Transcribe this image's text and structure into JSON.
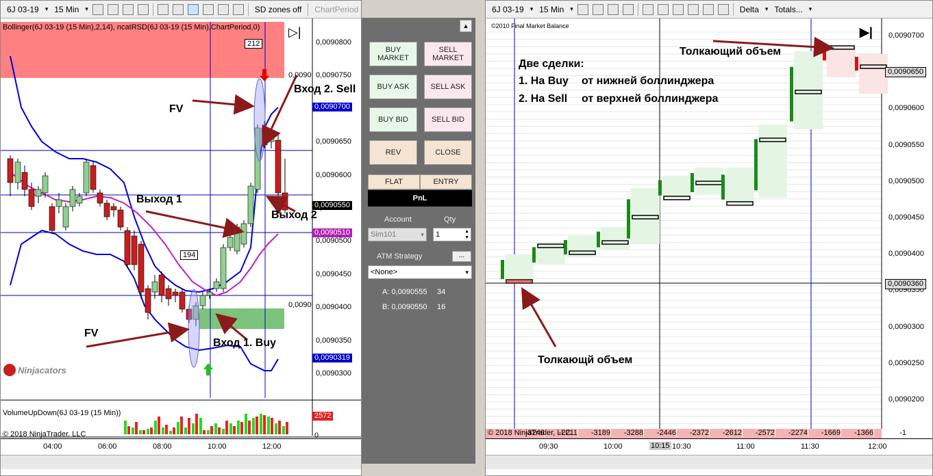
{
  "left": {
    "toolbar": {
      "instrument": "6J 03-19",
      "timeframe": "15 Min",
      "zones": "SD zones off",
      "chart_period": "ChartPeriod"
    },
    "indicator_label": "Bollinger(6J 03-19 (15 Min),2,14), ncatRSD(6J 03-19 (15 Min),ChartPeriod,0)",
    "box_212": "212",
    "box_194": "194",
    "price_axis": [
      "0,0090800",
      "0,0090750",
      "0,0090700",
      "0,0090650",
      "0,0090600",
      "0,0090550",
      "0,0090500",
      "0,0090450",
      "0,0090400",
      "0,0090350",
      "0,0090300"
    ],
    "partial_labels": [
      "0,0090",
      "0,0090"
    ],
    "tags": {
      "t1": "0,0090700",
      "t2": "0,0090550",
      "t3": "0,0090510",
      "t4": "0,0090319"
    },
    "annotations": {
      "fv_top": "FV",
      "fv_bottom": "FV",
      "entry_sell": "Вход 2. Sell",
      "exit1": "Выход 1",
      "exit2": "Выход 2",
      "entry_buy": "Вход 1. Buy"
    },
    "watermark": "Ninjacators",
    "volume": {
      "label": "VolumeUpDown(6J 03-19 (15 Min))",
      "tag": "2572",
      "zero": "0",
      "up": [
        20,
        10,
        6,
        8,
        20,
        10,
        5,
        18,
        10,
        16,
        24,
        6,
        16,
        8,
        16,
        20,
        30,
        24,
        30,
        26,
        16,
        12
      ],
      "down": [
        12,
        18,
        6,
        10,
        26,
        14,
        10,
        26,
        24,
        30,
        6,
        12,
        10,
        20,
        12,
        18,
        20,
        26,
        28,
        24,
        20,
        18
      ]
    },
    "copyright": "© 2018 NinjaTrader, LLC",
    "time_axis": [
      "04:00",
      "06:00",
      "08:00",
      "10:00",
      "12:00"
    ]
  },
  "controls": {
    "buy_market": "BUY MARKET",
    "sell_market": "SELL MARKET",
    "buy_ask": "BUY ASK",
    "sell_ask": "SELL ASK",
    "buy_bid": "BUY BID",
    "sell_bid": "SELL BID",
    "rev": "REV",
    "close": "CLOSE",
    "flat": "FLAT",
    "entry": "ENTRY",
    "pnl": "PnL",
    "account_label": "Account",
    "qty_label": "Qty",
    "account_value": "Sim101",
    "qty_value": "1",
    "atm_label": "ATM Strategy",
    "atm_button": "...",
    "atm_value": "<None>",
    "ask": "A: 0,0090555",
    "ask_size": "34",
    "bid": "B: 0,0090550",
    "bid_size": "16"
  },
  "right": {
    "toolbar": {
      "instrument": "6J 03-19",
      "timeframe": "15 Min",
      "delta": "Delta",
      "totals": "Totals..."
    },
    "header": "©2010 Final Market Balance",
    "price_axis": [
      "0,0090700",
      "0,0090650",
      "0,0090600",
      "0,0090550",
      "0,0090500",
      "0,0090450",
      "0,0090400",
      "0,0090350",
      "0,0090300",
      "0,0090250",
      "0,0090200"
    ],
    "tags": {
      "current": "0,0090650",
      "line": "0,0090360"
    },
    "annotations": {
      "title": "Две сделки:",
      "line1a": "1. На Buy",
      "line1b": "от нижней боллинджера",
      "line2a": "2. На Sell",
      "line2b": "от верхней боллинджера",
      "push_top": "Толкающий объем",
      "push_bottom": "Толкающй объем"
    },
    "delta_row": [
      "-3246",
      "-2211",
      "-3189",
      "-3288",
      "-2446",
      "-2372",
      "-2612",
      "-2572",
      "-2274",
      "-1669",
      "-1366",
      "-1"
    ],
    "copyright": "© 2018 NinjaTrader, LLC",
    "time_axis": [
      "09:30",
      "10:00",
      "10:30",
      "11:00",
      "11:30",
      "12:00"
    ],
    "time_highlight": "10:15"
  },
  "colors": {
    "bull": "#90d090",
    "bear": "#c81e1e",
    "band": "#0000dd",
    "mid": "#c020c0",
    "supply": "#ff8080",
    "demand": "#7cc47c"
  }
}
